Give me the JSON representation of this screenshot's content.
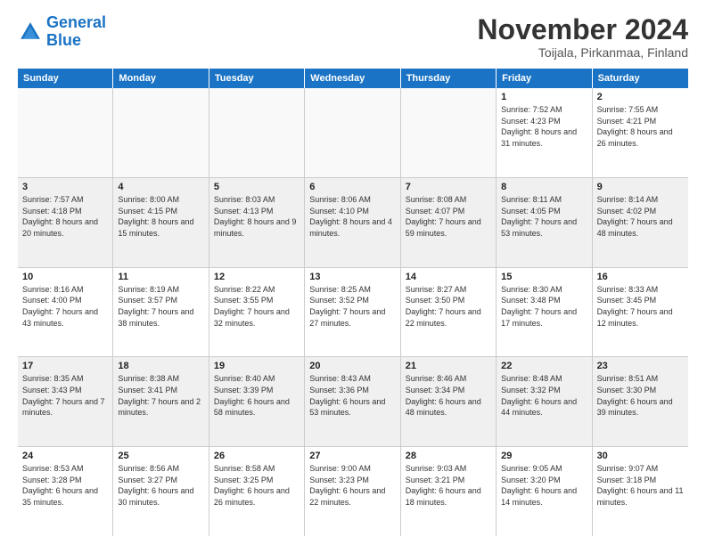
{
  "logo": {
    "line1": "General",
    "line2": "Blue"
  },
  "title": "November 2024",
  "subtitle": "Toijala, Pirkanmaa, Finland",
  "header_days": [
    "Sunday",
    "Monday",
    "Tuesday",
    "Wednesday",
    "Thursday",
    "Friday",
    "Saturday"
  ],
  "rows": [
    [
      {
        "day": "",
        "info": ""
      },
      {
        "day": "",
        "info": ""
      },
      {
        "day": "",
        "info": ""
      },
      {
        "day": "",
        "info": ""
      },
      {
        "day": "",
        "info": ""
      },
      {
        "day": "1",
        "info": "Sunrise: 7:52 AM\nSunset: 4:23 PM\nDaylight: 8 hours and 31 minutes."
      },
      {
        "day": "2",
        "info": "Sunrise: 7:55 AM\nSunset: 4:21 PM\nDaylight: 8 hours and 26 minutes."
      }
    ],
    [
      {
        "day": "3",
        "info": "Sunrise: 7:57 AM\nSunset: 4:18 PM\nDaylight: 8 hours and 20 minutes."
      },
      {
        "day": "4",
        "info": "Sunrise: 8:00 AM\nSunset: 4:15 PM\nDaylight: 8 hours and 15 minutes."
      },
      {
        "day": "5",
        "info": "Sunrise: 8:03 AM\nSunset: 4:13 PM\nDaylight: 8 hours and 9 minutes."
      },
      {
        "day": "6",
        "info": "Sunrise: 8:06 AM\nSunset: 4:10 PM\nDaylight: 8 hours and 4 minutes."
      },
      {
        "day": "7",
        "info": "Sunrise: 8:08 AM\nSunset: 4:07 PM\nDaylight: 7 hours and 59 minutes."
      },
      {
        "day": "8",
        "info": "Sunrise: 8:11 AM\nSunset: 4:05 PM\nDaylight: 7 hours and 53 minutes."
      },
      {
        "day": "9",
        "info": "Sunrise: 8:14 AM\nSunset: 4:02 PM\nDaylight: 7 hours and 48 minutes."
      }
    ],
    [
      {
        "day": "10",
        "info": "Sunrise: 8:16 AM\nSunset: 4:00 PM\nDaylight: 7 hours and 43 minutes."
      },
      {
        "day": "11",
        "info": "Sunrise: 8:19 AM\nSunset: 3:57 PM\nDaylight: 7 hours and 38 minutes."
      },
      {
        "day": "12",
        "info": "Sunrise: 8:22 AM\nSunset: 3:55 PM\nDaylight: 7 hours and 32 minutes."
      },
      {
        "day": "13",
        "info": "Sunrise: 8:25 AM\nSunset: 3:52 PM\nDaylight: 7 hours and 27 minutes."
      },
      {
        "day": "14",
        "info": "Sunrise: 8:27 AM\nSunset: 3:50 PM\nDaylight: 7 hours and 22 minutes."
      },
      {
        "day": "15",
        "info": "Sunrise: 8:30 AM\nSunset: 3:48 PM\nDaylight: 7 hours and 17 minutes."
      },
      {
        "day": "16",
        "info": "Sunrise: 8:33 AM\nSunset: 3:45 PM\nDaylight: 7 hours and 12 minutes."
      }
    ],
    [
      {
        "day": "17",
        "info": "Sunrise: 8:35 AM\nSunset: 3:43 PM\nDaylight: 7 hours and 7 minutes."
      },
      {
        "day": "18",
        "info": "Sunrise: 8:38 AM\nSunset: 3:41 PM\nDaylight: 7 hours and 2 minutes."
      },
      {
        "day": "19",
        "info": "Sunrise: 8:40 AM\nSunset: 3:39 PM\nDaylight: 6 hours and 58 minutes."
      },
      {
        "day": "20",
        "info": "Sunrise: 8:43 AM\nSunset: 3:36 PM\nDaylight: 6 hours and 53 minutes."
      },
      {
        "day": "21",
        "info": "Sunrise: 8:46 AM\nSunset: 3:34 PM\nDaylight: 6 hours and 48 minutes."
      },
      {
        "day": "22",
        "info": "Sunrise: 8:48 AM\nSunset: 3:32 PM\nDaylight: 6 hours and 44 minutes."
      },
      {
        "day": "23",
        "info": "Sunrise: 8:51 AM\nSunset: 3:30 PM\nDaylight: 6 hours and 39 minutes."
      }
    ],
    [
      {
        "day": "24",
        "info": "Sunrise: 8:53 AM\nSunset: 3:28 PM\nDaylight: 6 hours and 35 minutes."
      },
      {
        "day": "25",
        "info": "Sunrise: 8:56 AM\nSunset: 3:27 PM\nDaylight: 6 hours and 30 minutes."
      },
      {
        "day": "26",
        "info": "Sunrise: 8:58 AM\nSunset: 3:25 PM\nDaylight: 6 hours and 26 minutes."
      },
      {
        "day": "27",
        "info": "Sunrise: 9:00 AM\nSunset: 3:23 PM\nDaylight: 6 hours and 22 minutes."
      },
      {
        "day": "28",
        "info": "Sunrise: 9:03 AM\nSunset: 3:21 PM\nDaylight: 6 hours and 18 minutes."
      },
      {
        "day": "29",
        "info": "Sunrise: 9:05 AM\nSunset: 3:20 PM\nDaylight: 6 hours and 14 minutes."
      },
      {
        "day": "30",
        "info": "Sunrise: 9:07 AM\nSunset: 3:18 PM\nDaylight: 6 hours and 11 minutes."
      }
    ]
  ]
}
